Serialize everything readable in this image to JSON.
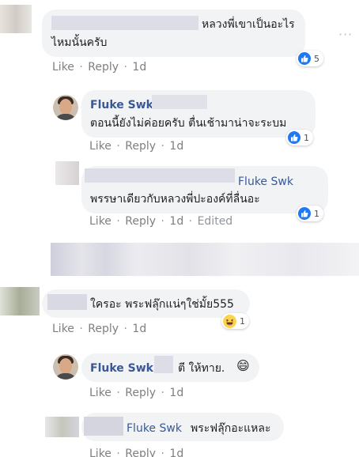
{
  "actions": {
    "like": "Like",
    "reply": "Reply",
    "separator": "·",
    "time": "1d",
    "edited": "Edited"
  },
  "more_options": "···",
  "comments": [
    {
      "line1": "หลวงพี่เขาเป็นอะไร",
      "line2": "ไหมนั้นครับ",
      "reaction": {
        "type": "like",
        "count": "5"
      }
    },
    {
      "author": "Fluke Swk",
      "text": "ตอนนี้ยังไม่ค่อยครับ ตื่นเช้ามาน่าจะระบม",
      "reaction": {
        "type": "like",
        "count": "1"
      }
    },
    {
      "mention": "Fluke Swk",
      "text": "พรรษาเดียวกับหลวงพี่ปะองค์ที่ลื่นอะ",
      "reaction": {
        "type": "like",
        "count": "1"
      }
    },
    {
      "text": "ใครอะ พระฟลุ๊กแน่ๆใช่มั้ย555",
      "reaction": {
        "type": "haha",
        "count": "1"
      }
    },
    {
      "author": "Fluke Swk",
      "text": "ตี ให้ทาย.",
      "emoji": "😄"
    },
    {
      "mention": "Fluke Swk",
      "text": "พระฟลุ๊กอะแหละ"
    }
  ]
}
